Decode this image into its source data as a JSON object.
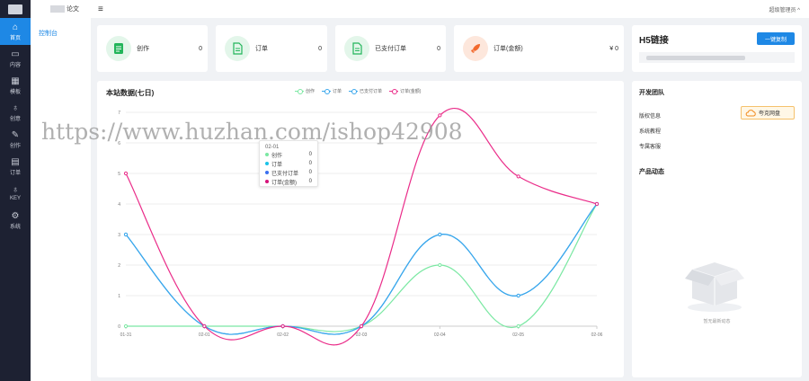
{
  "rail": [
    {
      "label": "首页",
      "icon": "home-icon",
      "glyph": "⌂",
      "active": true
    },
    {
      "label": "内容",
      "icon": "folder-icon",
      "glyph": "▭",
      "active": false
    },
    {
      "label": "模板",
      "icon": "grid-icon",
      "glyph": "▦",
      "active": false
    },
    {
      "label": "创意",
      "icon": "person-icon",
      "glyph": "♁",
      "active": false
    },
    {
      "label": "创作",
      "icon": "pen-icon",
      "glyph": "✎",
      "active": false
    },
    {
      "label": "订单",
      "icon": "list-icon",
      "glyph": "▤",
      "active": false
    },
    {
      "label": "KEY",
      "icon": "key-icon",
      "glyph": "♁",
      "active": false
    },
    {
      "label": "系统",
      "icon": "gear-icon",
      "glyph": "⚙",
      "active": false
    }
  ],
  "subnav": {
    "brand_suffix": "论文",
    "item": "控制台"
  },
  "topbar": {
    "user": "超级管理员 ^"
  },
  "stats": [
    {
      "label": "创作",
      "value": "0"
    },
    {
      "label": "订单",
      "value": "0"
    },
    {
      "label": "已支付订单",
      "value": "0"
    },
    {
      "label": "订单(金额)",
      "value": "¥ 0"
    }
  ],
  "h5": {
    "title": "H5链接",
    "copy": "一键复制"
  },
  "chart_title": "本站数据(七日)",
  "colors": {
    "创作": "#7be8a3",
    "订单": "#3aa7ec",
    "已支付订单": "#3aa7ec",
    "订单(金额)": "#ea2c89"
  },
  "chart_data": {
    "type": "line",
    "x": [
      "01-31",
      "02-01",
      "02-02",
      "02-03",
      "02-04",
      "02-05",
      "02-06"
    ],
    "ylim": [
      0,
      7
    ],
    "yticks": [
      "0",
      "1",
      "2",
      "3",
      "4",
      "5",
      "6",
      "7"
    ],
    "grid": true,
    "legend_position": "top",
    "series": [
      {
        "name": "创作",
        "color": "#7be8a3",
        "values": [
          0,
          0,
          0,
          0,
          2,
          0,
          4
        ]
      },
      {
        "name": "订单",
        "color": "#3aa7ec",
        "values": [
          3,
          0,
          0,
          0,
          3,
          1,
          4
        ]
      },
      {
        "name": "已支付订单",
        "color": "#3aa7ec",
        "values": [
          3,
          0,
          0,
          0,
          3,
          1,
          4
        ]
      },
      {
        "name": "订单(金额)",
        "color": "#ea2c89",
        "values": [
          5,
          0,
          0,
          0,
          6.9,
          4.9,
          4
        ]
      }
    ]
  },
  "tooltip": {
    "head": "02-01",
    "rows": [
      {
        "name": "创作",
        "value": "0",
        "color": "#7be8a3"
      },
      {
        "name": "订单",
        "value": "0",
        "color": "#1bc3e8"
      },
      {
        "name": "已支付订单",
        "value": "0",
        "color": "#3a6ff0"
      },
      {
        "name": "订单(金额)",
        "value": "0",
        "color": "#d6137a"
      }
    ]
  },
  "watermark": "https://www.huzhan.com/ishop42908",
  "dev": {
    "title": "开发团队",
    "rows": [
      "版权信息",
      "系统教程",
      "专属客服"
    ],
    "netdisk": "夸克网盘",
    "product_title": "产品动态",
    "empty_text": "暂无最新动态"
  }
}
